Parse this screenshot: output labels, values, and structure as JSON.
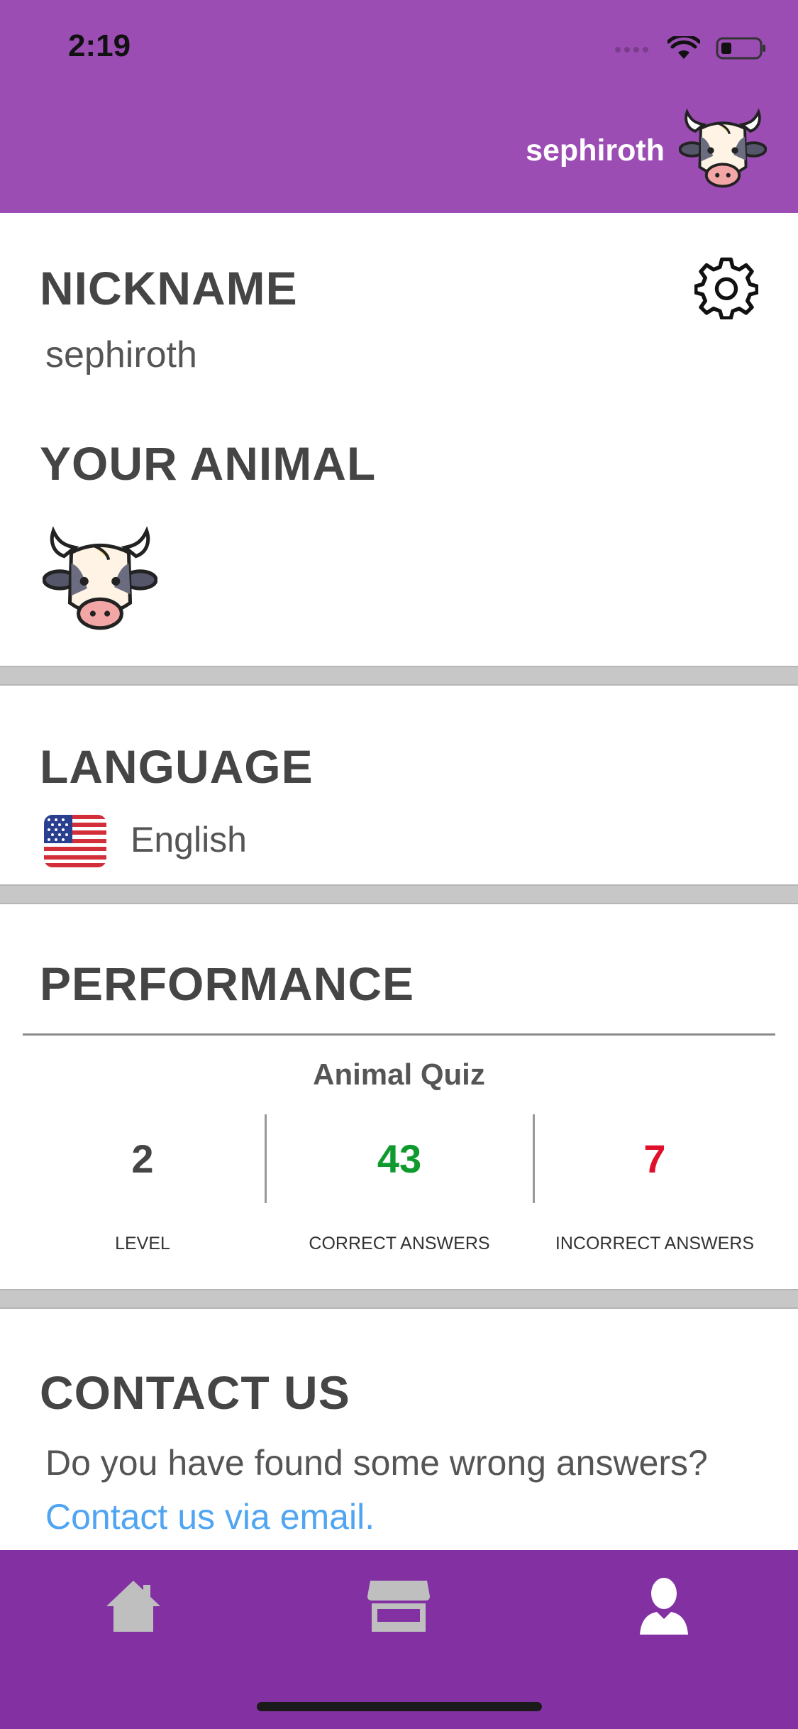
{
  "status_bar": {
    "time": "2:19"
  },
  "header": {
    "username": "sephiroth"
  },
  "profile": {
    "nickname_title": "NICKNAME",
    "nickname_value": "sephiroth",
    "animal_title": "YOUR ANIMAL"
  },
  "language": {
    "title": "LANGUAGE",
    "value": "English"
  },
  "performance": {
    "title": "PERFORMANCE",
    "quiz_name": "Animal Quiz",
    "stats": [
      {
        "value": "2",
        "label": "LEVEL",
        "color": "#454545"
      },
      {
        "value": "43",
        "label": "CORRECT ANSWERS",
        "color": "#0f9a2f"
      },
      {
        "value": "7",
        "label": "INCORRECT ANSWERS",
        "color": "#e0102a"
      }
    ]
  },
  "contact": {
    "title": "CONTACT US",
    "question": "Do you have found some wrong answers?",
    "link": "Contact us via email."
  },
  "tabbar": {
    "tabs": [
      "home-icon",
      "store-icon",
      "profile-icon"
    ],
    "active_index": 2
  },
  "colors": {
    "header": "#9b4db3",
    "tabbar": "#8330a3",
    "accent_link": "#4fa5f2"
  }
}
